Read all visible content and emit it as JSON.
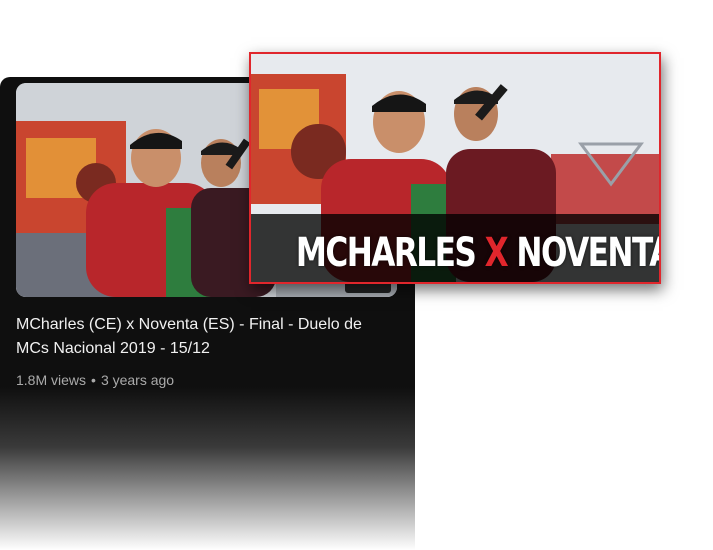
{
  "video": {
    "title": "MCharles (CE) x Noventa (ES) - Final - Duelo de MCs Nacional 2019 - 15/12",
    "views": "1.8M views",
    "separator": "•",
    "age": "3 years ago"
  },
  "thumbnail_overlay": {
    "left_text": "MCHARLES",
    "mid_text": "X",
    "right_text": "NOVENTA"
  },
  "colors": {
    "card_background": "#0f0f0f",
    "highlight_border": "#e0262c",
    "title_text": "#f1f1f1",
    "meta_text": "#aaaaaa"
  }
}
